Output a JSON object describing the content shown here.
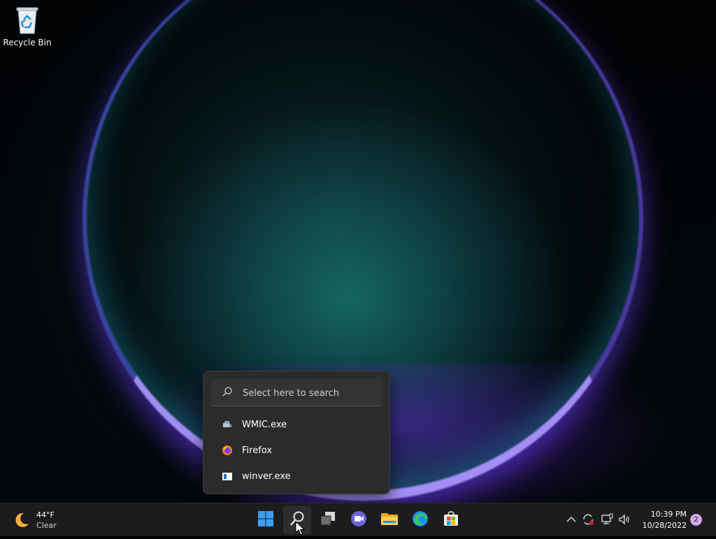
{
  "desktop": {
    "icons": [
      {
        "label": "Recycle Bin",
        "icon": "recycle-bin-icon"
      }
    ]
  },
  "search_flyout": {
    "placeholder": "Select here to search",
    "results": [
      {
        "label": "WMIC.exe",
        "icon": "wmic-app-icon"
      },
      {
        "label": "Firefox",
        "icon": "firefox-icon"
      },
      {
        "label": "winver.exe",
        "icon": "winver-app-icon"
      }
    ]
  },
  "taskbar": {
    "weather": {
      "temperature": "44°F",
      "condition": "Clear",
      "icon": "moon-icon"
    },
    "apps": [
      {
        "name": "Start",
        "icon": "windows-start-icon"
      },
      {
        "name": "Search",
        "icon": "search-icon",
        "active": true
      },
      {
        "name": "Task View",
        "icon": "task-view-icon"
      },
      {
        "name": "Chat",
        "icon": "teams-chat-icon"
      },
      {
        "name": "File Explorer",
        "icon": "file-explorer-icon"
      },
      {
        "name": "Microsoft Edge",
        "icon": "edge-icon"
      },
      {
        "name": "Microsoft Store",
        "icon": "store-icon"
      }
    ],
    "tray": [
      "chevron-up-icon",
      "sync-icon",
      "network-icon",
      "volume-icon"
    ],
    "clock": {
      "time": "10:39 PM",
      "date": "10/28/2022"
    },
    "notifications": "2"
  },
  "colors": {
    "taskbar": "#1c1c1c",
    "flyout": "#2b2b2b",
    "accent_blue": "#3aa0f3",
    "badge": "#d3a6e6"
  }
}
